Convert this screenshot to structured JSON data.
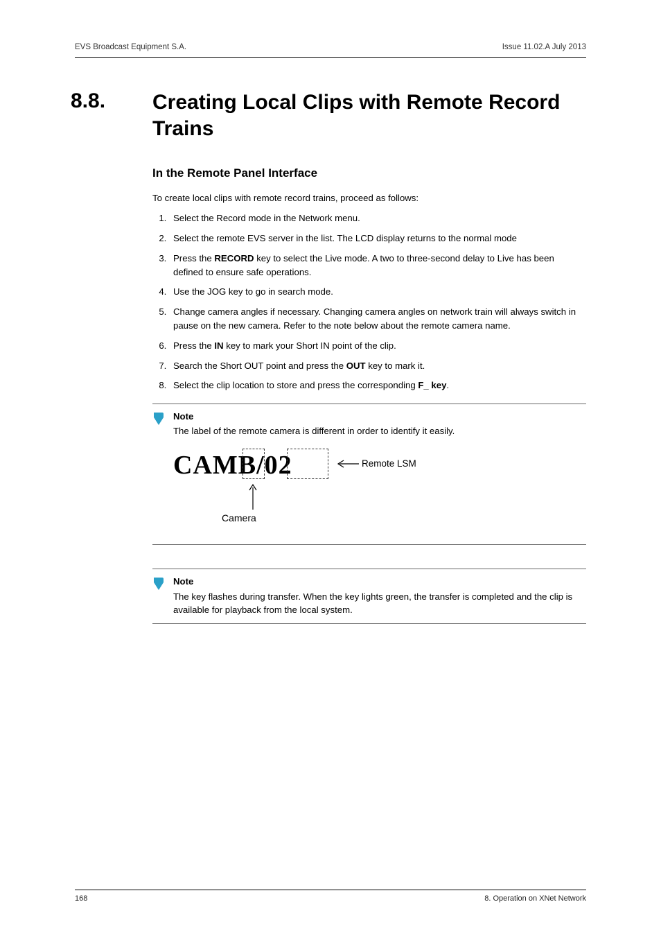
{
  "header": {
    "left": "EVS Broadcast Equipment S.A.",
    "right": "Issue 11.02.A  July 2013"
  },
  "section": {
    "number": "8.8.",
    "title": "Creating Local Clips with Remote Record Trains"
  },
  "h2": "In the Remote Panel Interface",
  "intro": "To create local clips with remote record trains, proceed as follows:",
  "steps": {
    "s1": "Select the Record mode in the Network menu.",
    "s2": "Select the remote EVS server in the list. The LCD display returns to the normal mode",
    "s3a": "Press the ",
    "s3b": "RECORD",
    "s3c": " key to select the Live mode. A two to three-second delay to Live has been defined to ensure safe operations.",
    "s4": "Use the JOG key to go in search mode.",
    "s5": "Change camera angles if necessary. Changing camera angles on network train will always switch in pause on the new camera. Refer to the note below about the remote camera name.",
    "s6a": "Press the ",
    "s6b": "IN",
    "s6c": " key to mark your Short IN point of the clip.",
    "s7a": "Search the Short OUT point and press the ",
    "s7b": "OUT",
    "s7c": " key to mark it.",
    "s8a": "Select the clip location to store and press the corresponding ",
    "s8b": "F_ key",
    "s8c": "."
  },
  "note1": {
    "heading": "Note",
    "body": "The label of the remote camera is different in order to identify it easily."
  },
  "diagram": {
    "camb": "CAMB/02",
    "remote": "Remote LSM",
    "camera": "Camera"
  },
  "note2": {
    "heading": "Note",
    "body": "The key flashes during transfer. When the key lights green, the transfer is completed and the clip is available for playback from the local system."
  },
  "footer": {
    "left": "168",
    "right": "8. Operation on XNet Network"
  }
}
